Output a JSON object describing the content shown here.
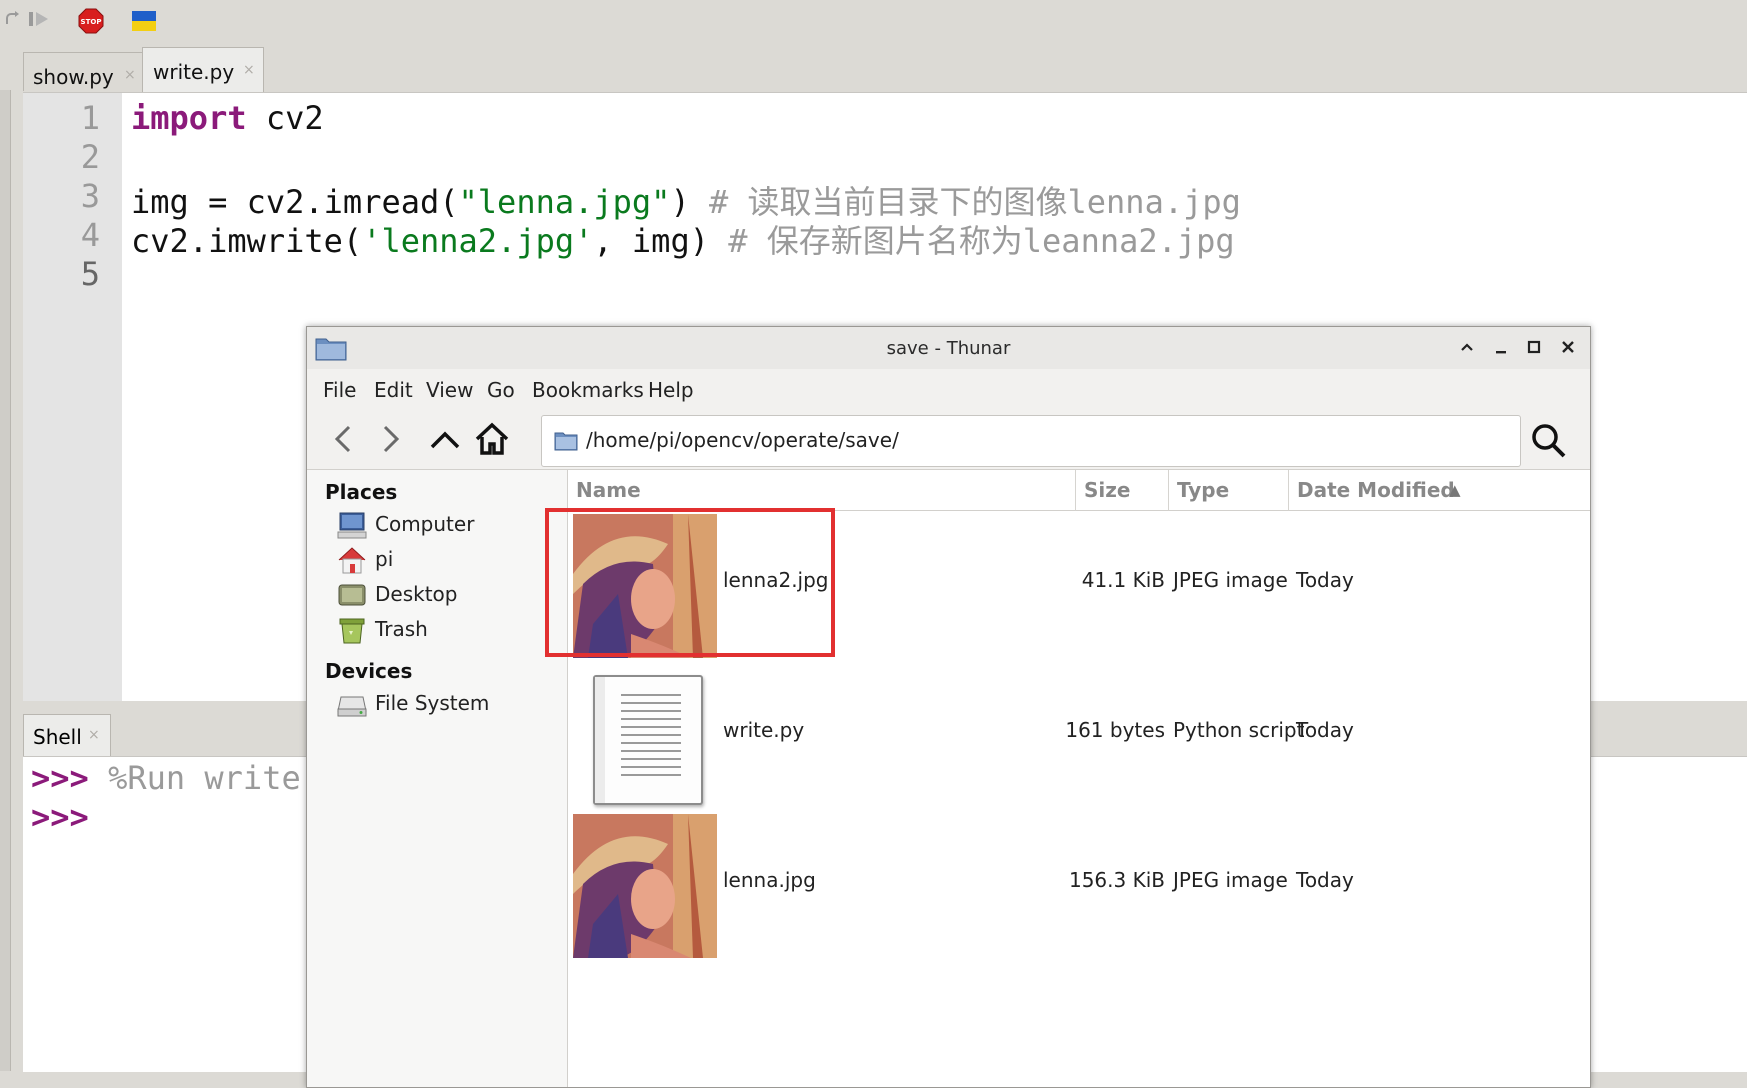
{
  "toolbar": {
    "icons": [
      "redo-icon",
      "resume-icon",
      "stop-icon",
      "flag-icon"
    ]
  },
  "editor": {
    "tabs": [
      {
        "label": "show.py",
        "close": "×"
      },
      {
        "label": "write.py",
        "close": "×"
      }
    ],
    "line_numbers": [
      "1",
      "2",
      "3",
      "4",
      "5"
    ],
    "lines": {
      "l1_kw": "import",
      "l1_rest": " cv2",
      "l3_a": "img = cv2.imread(",
      "l3_str": "\"lenna.jpg\"",
      "l3_b": ") ",
      "l3_cmt": "# 读取当前目录下的图像lenna.jpg",
      "l4_a": "cv2.imwrite(",
      "l4_str": "'lenna2.jpg'",
      "l4_b": ", img) ",
      "l4_cmt": "# 保存新图片名称为leanna2.jpg"
    }
  },
  "shell": {
    "tab_label": "Shell",
    "close": "×",
    "prompt": ">>>",
    "command": " %Run write.py"
  },
  "thunar": {
    "title": "save - Thunar",
    "menu": [
      "File",
      "Edit",
      "View",
      "Go",
      "Bookmarks",
      "Help"
    ],
    "path": "/home/pi/opencv/operate/save/",
    "places_heading": "Places",
    "places": [
      "Computer",
      "pi",
      "Desktop",
      "Trash"
    ],
    "devices_heading": "Devices",
    "devices": [
      "File System"
    ],
    "columns": [
      "Name",
      "Size",
      "Type",
      "Date Modified"
    ],
    "sort_indicator": "▲",
    "files": [
      {
        "name": "lenna2.jpg",
        "size": "41.1 KiB",
        "type": "JPEG image",
        "date": "Today"
      },
      {
        "name": "write.py",
        "size": "161 bytes",
        "type": "Python script",
        "date": "Today"
      },
      {
        "name": "lenna.jpg",
        "size": "156.3 KiB",
        "type": "JPEG image",
        "date": "Today"
      }
    ],
    "colors": {
      "highlight": "#e23030",
      "keyword": "#8b1a7a",
      "string": "#0a7a1e"
    }
  }
}
